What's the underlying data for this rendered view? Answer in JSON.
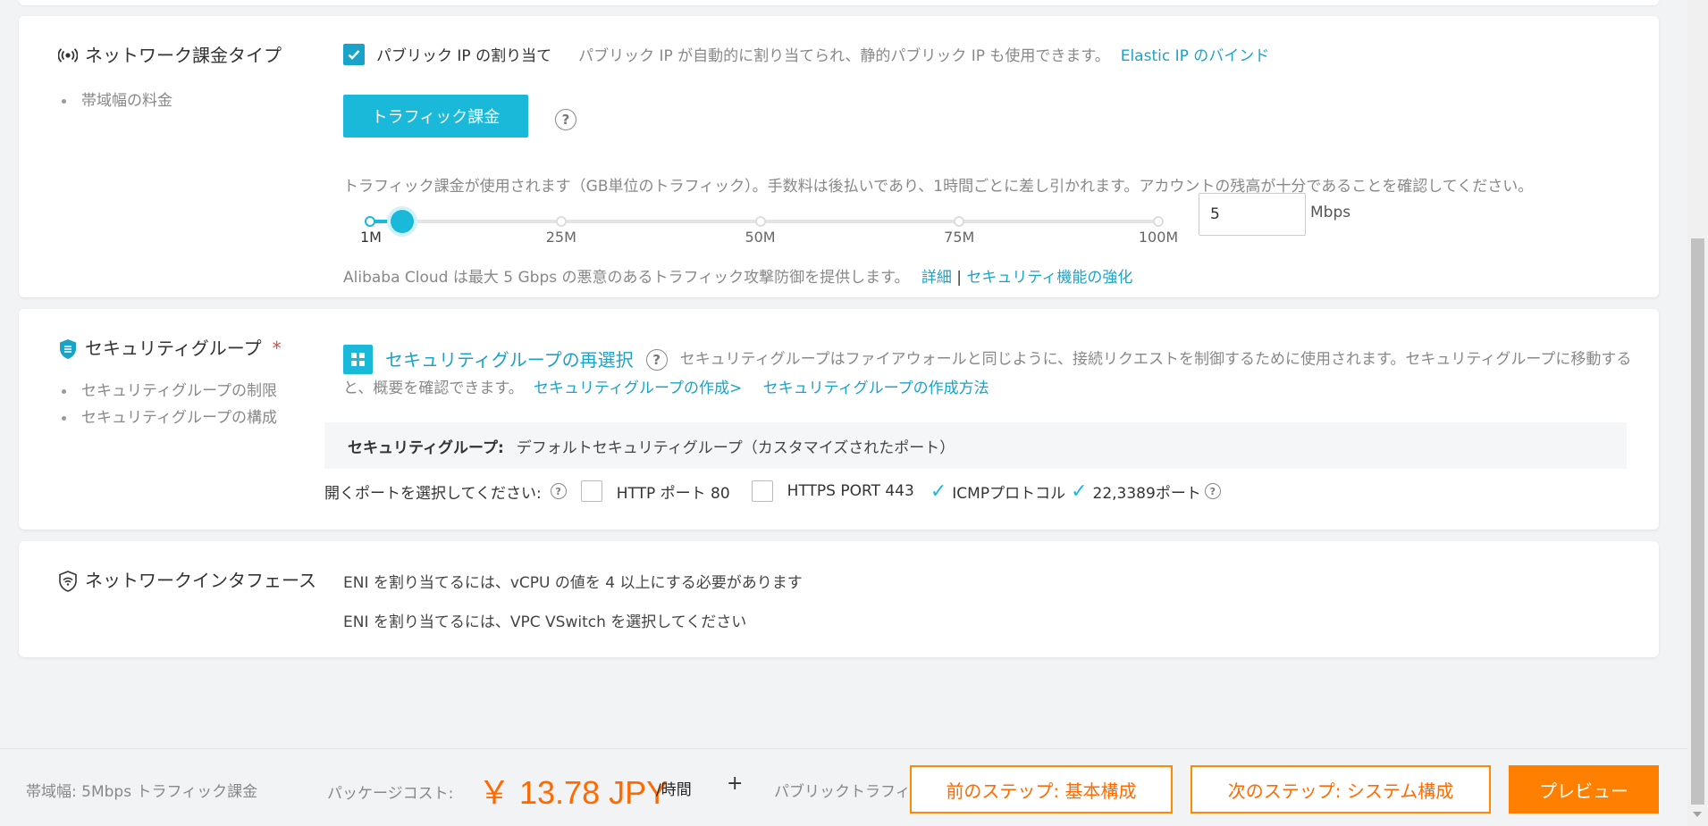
{
  "network": {
    "title": "ネットワーク課金タイプ",
    "sub_items": [
      "帯域幅の料金"
    ],
    "public_ip_checkbox_label": "パブリック IP の割り当て",
    "public_ip_desc": "パブリック IP が自動的に割り当てられ、静的パブリック IP も使用できます。",
    "elastic_ip_link": "Elastic IP のバインド",
    "traffic_button": "トラフィック課金",
    "traffic_desc": "トラフィック課金が使用されます（GB単位のトラフィック）。手数料は後払いであり、1時間ごとに差し引かれます。アカウントの残高が十分であることを確認してください。",
    "bandwidth": {
      "min": 1,
      "max": 100,
      "value": 5,
      "ticks": [
        "1M",
        "25M",
        "50M",
        "75M",
        "100M"
      ],
      "tick_values": [
        1,
        25,
        50,
        75,
        100
      ],
      "input_value": "5",
      "unit": "Mbps"
    },
    "protection_text": "Alibaba Cloud は最大 5 Gbps の悪意のあるトラフィック攻撃防御を提供します。",
    "details_link": "詳細",
    "separator": "|",
    "security_link": "セキュリティ機能の強化"
  },
  "security": {
    "title": "セキュリティグループ",
    "required_mark": "*",
    "sub_items": [
      "セキュリティグループの制限",
      "セキュリティグループの構成"
    ],
    "reselect_label": "セキュリティグループの再選択",
    "description": "セキュリティグループはファイアウォールと同じように、接続リクエストを制御するために使用されます。セキュリティグループに移動すると、概要を確認できます。",
    "create_link": "セキュリティグループの作成>",
    "howto_link": "セキュリティグループの作成方法",
    "current_label": "セキュリティグループ:",
    "current_value": "デフォルトセキュリティグループ（カスタマイズされたポート）",
    "ports_prompt": "開くポートを選択してください:",
    "ports": [
      {
        "label": "HTTP ポート 80",
        "checked": false
      },
      {
        "label": "HTTPS PORT 443",
        "checked": false
      },
      {
        "label": "ICMPプロトコル",
        "checked": true
      },
      {
        "label": "22,3389ポート",
        "checked": true
      }
    ]
  },
  "eni": {
    "title": "ネットワークインタフェース",
    "line1": "ENI を割り当てるには、vCPU の値を 4 以上にする必要があります",
    "line2": "ENI を割り当てるには、VPC VSwitch を選択してください"
  },
  "footer": {
    "bandwidth_summary": "帯域幅: 5Mbps トラフィック課金",
    "package_label": "パッケージコスト:",
    "price": "￥ 13.78 JPY",
    "per_hour": "/時間",
    "plus": "+",
    "public_traffic_label": "パブリックトラフィック",
    "prev_button": "前のステップ: 基本構成",
    "next_button": "次のステップ: システム構成",
    "preview_button": "プレビュー"
  },
  "colors": {
    "accent": "#1ab8d9",
    "link": "#1aa3c8",
    "price": "#ff6a00",
    "preview_button": "#ff8000"
  },
  "icons": {
    "network": "broadcast-icon",
    "security": "shield-icon",
    "eni": "wifi-shield-icon",
    "reselect": "grid-icon",
    "help": "question-circle-icon",
    "checked": "checkmark-icon"
  }
}
